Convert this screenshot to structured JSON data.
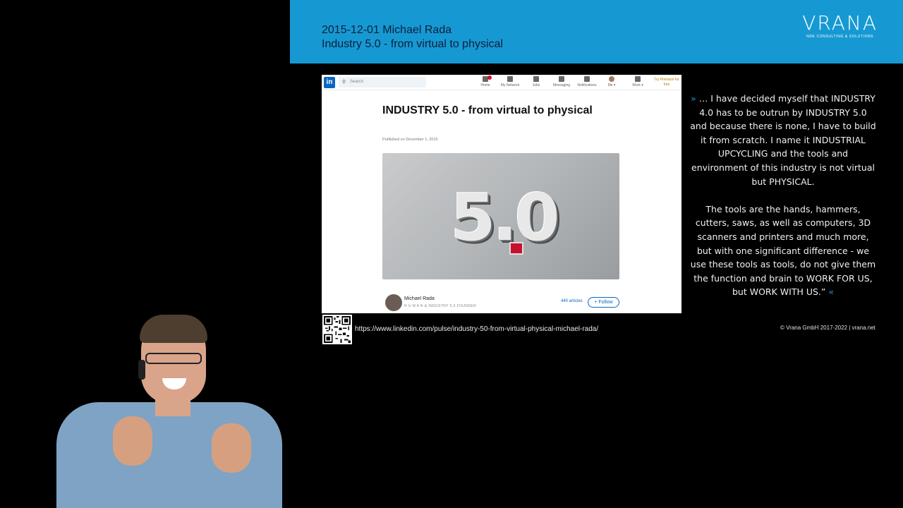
{
  "header": {
    "line1": "2015-12-01 Michael Rada",
    "line2": "Industry 5.0 - from virtual to physical",
    "brand_name": "VRANA",
    "brand_tagline": "NDE CONSULTING & SOLUTIONS",
    "accent_color": "#1699d3"
  },
  "screenshot": {
    "nav": {
      "logo": "in",
      "search_placeholder": "Search",
      "items": [
        {
          "label": "Home",
          "icon": "home-icon"
        },
        {
          "label": "My Network",
          "icon": "network-icon"
        },
        {
          "label": "Jobs",
          "icon": "briefcase-icon"
        },
        {
          "label": "Messaging",
          "icon": "message-icon"
        },
        {
          "label": "Notifications",
          "icon": "bell-icon"
        },
        {
          "label": "Me ▾",
          "icon": "avatar-icon"
        },
        {
          "label": "Work ▾",
          "icon": "grid-icon"
        }
      ],
      "premium": "Try Premium for free"
    },
    "article": {
      "title": "INDUSTRY 5.0 - from virtual to physical",
      "date": "Published on December 1, 2015",
      "image_text": "5.0"
    },
    "author": {
      "name": "Michael Rada",
      "headline": "H U M A N & INDUSTRY 5.0 FOUNDER",
      "articles": "440 articles",
      "follow": "+ Follow"
    }
  },
  "source_url": "https://www.linkedin.com/pulse/industry-50-from-virtual-physical-michael-rada/",
  "quote": {
    "open": "»",
    "paragraph1": "… I have decided myself that INDUSTRY 4.0 has to be outrun by INDUSTRY 5.0 and because there is none, I have to build it from scratch. I name it INDUSTRIAL UPCYCLING and the tools and environment of this industry is not virtual but PHYSICAL.",
    "paragraph2": "The tools are the hands, hammers, cutters, saws, as well as computers, 3D scanners and printers and much more, but with one significant difference - we use these tools as tools, do not give them the function and brain to WORK FOR US, but WORK WITH US.”",
    "close": "«"
  },
  "copyright": "© Vrana GmbH 2017-2022 | vrana.net"
}
